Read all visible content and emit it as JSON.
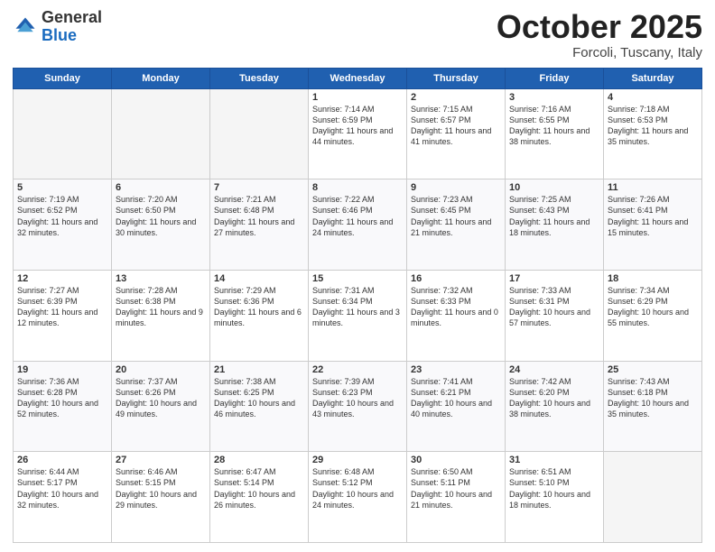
{
  "logo": {
    "general": "General",
    "blue": "Blue"
  },
  "title": "October 2025",
  "location": "Forcoli, Tuscany, Italy",
  "days_of_week": [
    "Sunday",
    "Monday",
    "Tuesday",
    "Wednesday",
    "Thursday",
    "Friday",
    "Saturday"
  ],
  "weeks": [
    [
      {
        "day": "",
        "info": ""
      },
      {
        "day": "",
        "info": ""
      },
      {
        "day": "",
        "info": ""
      },
      {
        "day": "1",
        "info": "Sunrise: 7:14 AM\nSunset: 6:59 PM\nDaylight: 11 hours and 44 minutes."
      },
      {
        "day": "2",
        "info": "Sunrise: 7:15 AM\nSunset: 6:57 PM\nDaylight: 11 hours and 41 minutes."
      },
      {
        "day": "3",
        "info": "Sunrise: 7:16 AM\nSunset: 6:55 PM\nDaylight: 11 hours and 38 minutes."
      },
      {
        "day": "4",
        "info": "Sunrise: 7:18 AM\nSunset: 6:53 PM\nDaylight: 11 hours and 35 minutes."
      }
    ],
    [
      {
        "day": "5",
        "info": "Sunrise: 7:19 AM\nSunset: 6:52 PM\nDaylight: 11 hours and 32 minutes."
      },
      {
        "day": "6",
        "info": "Sunrise: 7:20 AM\nSunset: 6:50 PM\nDaylight: 11 hours and 30 minutes."
      },
      {
        "day": "7",
        "info": "Sunrise: 7:21 AM\nSunset: 6:48 PM\nDaylight: 11 hours and 27 minutes."
      },
      {
        "day": "8",
        "info": "Sunrise: 7:22 AM\nSunset: 6:46 PM\nDaylight: 11 hours and 24 minutes."
      },
      {
        "day": "9",
        "info": "Sunrise: 7:23 AM\nSunset: 6:45 PM\nDaylight: 11 hours and 21 minutes."
      },
      {
        "day": "10",
        "info": "Sunrise: 7:25 AM\nSunset: 6:43 PM\nDaylight: 11 hours and 18 minutes."
      },
      {
        "day": "11",
        "info": "Sunrise: 7:26 AM\nSunset: 6:41 PM\nDaylight: 11 hours and 15 minutes."
      }
    ],
    [
      {
        "day": "12",
        "info": "Sunrise: 7:27 AM\nSunset: 6:39 PM\nDaylight: 11 hours and 12 minutes."
      },
      {
        "day": "13",
        "info": "Sunrise: 7:28 AM\nSunset: 6:38 PM\nDaylight: 11 hours and 9 minutes."
      },
      {
        "day": "14",
        "info": "Sunrise: 7:29 AM\nSunset: 6:36 PM\nDaylight: 11 hours and 6 minutes."
      },
      {
        "day": "15",
        "info": "Sunrise: 7:31 AM\nSunset: 6:34 PM\nDaylight: 11 hours and 3 minutes."
      },
      {
        "day": "16",
        "info": "Sunrise: 7:32 AM\nSunset: 6:33 PM\nDaylight: 11 hours and 0 minutes."
      },
      {
        "day": "17",
        "info": "Sunrise: 7:33 AM\nSunset: 6:31 PM\nDaylight: 10 hours and 57 minutes."
      },
      {
        "day": "18",
        "info": "Sunrise: 7:34 AM\nSunset: 6:29 PM\nDaylight: 10 hours and 55 minutes."
      }
    ],
    [
      {
        "day": "19",
        "info": "Sunrise: 7:36 AM\nSunset: 6:28 PM\nDaylight: 10 hours and 52 minutes."
      },
      {
        "day": "20",
        "info": "Sunrise: 7:37 AM\nSunset: 6:26 PM\nDaylight: 10 hours and 49 minutes."
      },
      {
        "day": "21",
        "info": "Sunrise: 7:38 AM\nSunset: 6:25 PM\nDaylight: 10 hours and 46 minutes."
      },
      {
        "day": "22",
        "info": "Sunrise: 7:39 AM\nSunset: 6:23 PM\nDaylight: 10 hours and 43 minutes."
      },
      {
        "day": "23",
        "info": "Sunrise: 7:41 AM\nSunset: 6:21 PM\nDaylight: 10 hours and 40 minutes."
      },
      {
        "day": "24",
        "info": "Sunrise: 7:42 AM\nSunset: 6:20 PM\nDaylight: 10 hours and 38 minutes."
      },
      {
        "day": "25",
        "info": "Sunrise: 7:43 AM\nSunset: 6:18 PM\nDaylight: 10 hours and 35 minutes."
      }
    ],
    [
      {
        "day": "26",
        "info": "Sunrise: 6:44 AM\nSunset: 5:17 PM\nDaylight: 10 hours and 32 minutes."
      },
      {
        "day": "27",
        "info": "Sunrise: 6:46 AM\nSunset: 5:15 PM\nDaylight: 10 hours and 29 minutes."
      },
      {
        "day": "28",
        "info": "Sunrise: 6:47 AM\nSunset: 5:14 PM\nDaylight: 10 hours and 26 minutes."
      },
      {
        "day": "29",
        "info": "Sunrise: 6:48 AM\nSunset: 5:12 PM\nDaylight: 10 hours and 24 minutes."
      },
      {
        "day": "30",
        "info": "Sunrise: 6:50 AM\nSunset: 5:11 PM\nDaylight: 10 hours and 21 minutes."
      },
      {
        "day": "31",
        "info": "Sunrise: 6:51 AM\nSunset: 5:10 PM\nDaylight: 10 hours and 18 minutes."
      },
      {
        "day": "",
        "info": ""
      }
    ]
  ]
}
